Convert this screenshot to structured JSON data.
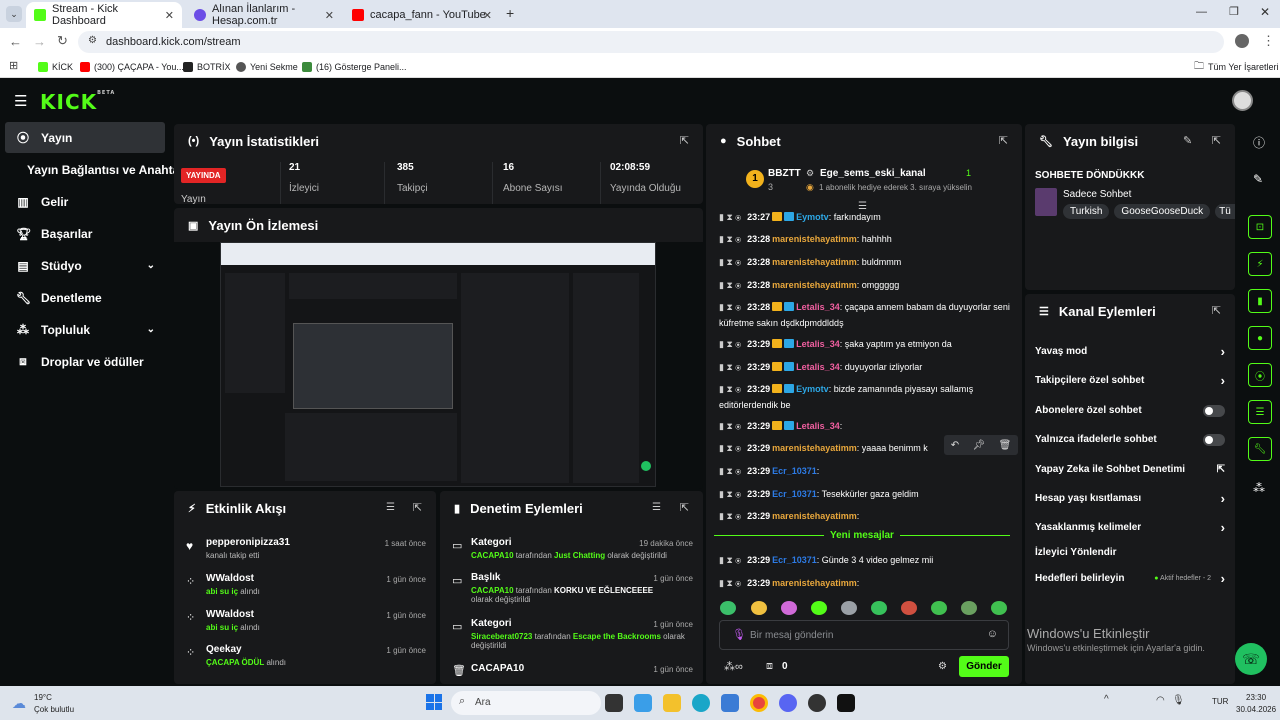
{
  "browser": {
    "tabs": [
      {
        "title": "Stream - Kick Dashboard",
        "color": "#53fc18"
      },
      {
        "title": "Alınan İlanlarım - Hesap.com.tr",
        "color": "#6b4de6"
      },
      {
        "title": "cacapa_fann - YouTube",
        "color": "#ff0000"
      }
    ],
    "url": "dashboard.kick.com/stream",
    "bookmarks": [
      "KİCK",
      "(300) ÇAÇAPA - You...",
      "BOTRİX",
      "Yeni Sekme",
      "(16) Gösterge Paneli..."
    ],
    "all_bookmarks": "Tüm Yer İşaretleri"
  },
  "kick": {
    "logo": "KICK",
    "logo_sup": "BETA",
    "sidebar": [
      {
        "label": "Yayın",
        "icon": "broadcast-icon"
      },
      {
        "label": "Yayın Bağlantısı ve Anahtarı",
        "icon": ""
      },
      {
        "label": "Gelir",
        "icon": "revenue-icon"
      },
      {
        "label": "Başarılar",
        "icon": "trophy-icon"
      },
      {
        "label": "Stüdyo",
        "icon": "studio-icon"
      },
      {
        "label": "Denetleme",
        "icon": "wrench-icon"
      },
      {
        "label": "Topluluk",
        "icon": "community-icon"
      },
      {
        "label": "Droplar ve ödüller",
        "icon": "gift-icon"
      }
    ],
    "stats": {
      "title": "Yayın İstatistikleri",
      "live_badge": "YAYINDA",
      "live_label": "Yayın",
      "items": [
        {
          "value": "21",
          "label": "İzleyici"
        },
        {
          "value": "385",
          "label": "Takipçi"
        },
        {
          "value": "16",
          "label": "Abone Sayısı"
        },
        {
          "value": "02:08:59",
          "label": "Yayında Olduğu"
        }
      ]
    },
    "preview": {
      "title": "Yayın Ön İzlemesi"
    },
    "activity": {
      "title": "Etkinlik Akışı",
      "items": [
        {
          "name": "pepperonipizza31",
          "sub": "kanalı takip etti",
          "time": "1 saat önce",
          "icon": "heart-icon"
        },
        {
          "name": "WWaldost",
          "sub_green": "abi su iç",
          "sub": " alındı",
          "time": "1 gün önce",
          "icon": "redeem-icon"
        },
        {
          "name": "WWaldost",
          "sub_green": "abi su iç",
          "sub": " alındı",
          "time": "1 gün önce",
          "icon": "redeem-icon"
        },
        {
          "name": "Qeekay",
          "sub_green": "ÇACAPA ÖDÜL",
          "sub": " alındı",
          "time": "1 gün önce",
          "icon": "redeem-icon"
        }
      ]
    },
    "moderation": {
      "title": "Denetim Eylemleri",
      "items": [
        {
          "title": "Kategori",
          "time": "19 dakika önce",
          "who": "CACAPA10",
          "text1": " tarafından ",
          "hl": "Just Chatting",
          "text2": " olarak değiştirildi"
        },
        {
          "title": "Başlık",
          "time": "1 gün önce",
          "who": "CACAPA10",
          "text1": " tarafından ",
          "hl": "KORKU VE EĞLENCEEEE",
          "text2": " olarak değiştirildi"
        },
        {
          "title": "Kategori",
          "time": "1 gün önce",
          "who": "Siraceberat0723",
          "text1": " tarafından ",
          "hl": "Escape the Backrooms",
          "text2": " olarak değiştirildi"
        },
        {
          "title": "CACAPA10",
          "time": "1 gün önce",
          "who": "",
          "text1": "",
          "hl": "",
          "text2": ""
        }
      ]
    },
    "chat": {
      "title": "Sohbet",
      "pinned": {
        "rank": "1",
        "user": "BBZTT",
        "count": "3",
        "channel": "Ege_sems_eski_kanal",
        "gift_count": "1",
        "note": "1 abonelik hediye ederek 3. sıraya yükselin"
      },
      "messages": [
        {
          "time": "23:27",
          "user": "Eymotv",
          "color": "#2da7e5",
          "text": "farkındayım",
          "badges": true
        },
        {
          "time": "23:28",
          "user": "marenistehayatimm",
          "color": "#e8a73c",
          "text": "hahhhh",
          "badges": false
        },
        {
          "time": "23:28",
          "user": "marenistehayatimm",
          "color": "#e8a73c",
          "text": "buldmmm",
          "badges": false
        },
        {
          "time": "23:28",
          "user": "marenistehayatimm",
          "color": "#e8a73c",
          "text": "omggggg",
          "badges": false
        },
        {
          "time": "23:28",
          "user": "Letalis_34",
          "color": "#f05fa0",
          "text": "çaçapa annem babam da duyuyorlar seni küfretme sakın dşdkdpmddlddş",
          "badges": true
        },
        {
          "time": "23:29",
          "user": "Letalis_34",
          "color": "#f05fa0",
          "text": "şaka yaptım ya etmiyon da",
          "badges": true
        },
        {
          "time": "23:29",
          "user": "Letalis_34",
          "color": "#f05fa0",
          "text": "duyuyorlar izliyorlar",
          "badges": true
        },
        {
          "time": "23:29",
          "user": "Eymotv",
          "color": "#2da7e5",
          "text": "bizde zamanında piyasayı sallamış editörlerdendik be",
          "badges": true
        },
        {
          "time": "23:29",
          "user": "Letalis_34",
          "color": "#f05fa0",
          "text": "",
          "badges": true
        },
        {
          "time": "23:29",
          "user": "marenistehayatimm",
          "color": "#e8a73c",
          "text": "yaaaa benimm k",
          "badges": false
        },
        {
          "time": "23:29",
          "user": "Ecr_10371",
          "color": "#2d7be5",
          "text": "",
          "badges": false
        },
        {
          "time": "23:29",
          "user": "Ecr_10371",
          "color": "#2d7be5",
          "text": "Tesekkürler gaza geldim",
          "badges": false
        },
        {
          "time": "23:29",
          "user": "marenistehayatimm",
          "color": "#e8a73c",
          "text": "",
          "badges": false
        },
        {
          "time": "23:29",
          "user": "Ecr_10371",
          "color": "#2d7be5",
          "text": "Günde 3 4 video gelmez mii",
          "badges": false
        },
        {
          "time": "23:29",
          "user": "marenistehayatimm",
          "color": "#e8a73c",
          "text": "",
          "badges": false
        }
      ],
      "new_messages": "Yeni mesajlar",
      "input_placeholder": "Bir mesaj gönderin",
      "count": "0",
      "send": "Gönder"
    },
    "stream_info": {
      "title": "Yayın bilgisi",
      "stream_title": "SOHBETE DÖNDÜKKK",
      "category": "Sadece Sohbet",
      "tags": [
        "Turkish",
        "GooseGooseDuck",
        "Tü"
      ]
    },
    "channel_actions": {
      "title": "Kanal Eylemleri",
      "items": [
        {
          "label": "Yavaş mod",
          "type": "arrow"
        },
        {
          "label": "Takipçilere özel sohbet",
          "type": "arrow"
        },
        {
          "label": "Abonelere özel sohbet",
          "type": "toggle"
        },
        {
          "label": "Yalnızca ifadelerle sohbet",
          "type": "toggle"
        },
        {
          "label": "Yapay Zeka ile Sohbet Denetimi",
          "type": "external"
        },
        {
          "label": "Hesap yaşı kısıtlaması",
          "type": "arrow"
        },
        {
          "label": "Yasaklanmış kelimeler",
          "type": "arrow"
        },
        {
          "label": "İzleyici Yönlendir",
          "type": "none"
        },
        {
          "label": "Hedefleri belirleyin",
          "type": "arrow",
          "extra": "Aktif hedefler - 2"
        }
      ]
    }
  },
  "windows_watermark": {
    "title": "Windows'u Etkinleştir",
    "sub": "Windows'u etkinleştirmek için Ayarlar'a gidin."
  },
  "taskbar": {
    "weather_temp": "19°C",
    "weather_desc": "Çok bulutlu",
    "search": "Ara",
    "lang": "TUR",
    "time": "23:30",
    "date": "30.04.2026"
  }
}
